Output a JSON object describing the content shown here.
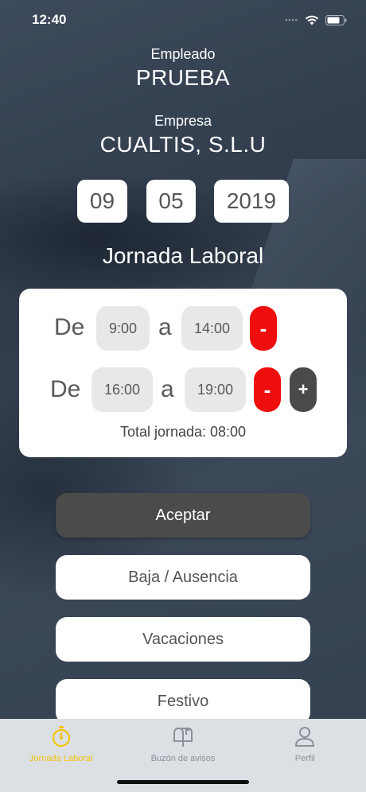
{
  "status": {
    "time": "12:40"
  },
  "employee": {
    "label": "Empleado",
    "value": "PRUEBA"
  },
  "company": {
    "label": "Empresa",
    "value": "CUALTIS, S.L.U"
  },
  "date": {
    "day": "09",
    "month": "05",
    "year": "2019"
  },
  "section_title": "Jornada Laboral",
  "shifts": [
    {
      "from_label": "De",
      "from": "9:00",
      "to_label": "a",
      "to": "14:00",
      "remove": "-"
    },
    {
      "from_label": "De",
      "from": "16:00",
      "to_label": "a",
      "to": "19:00",
      "remove": "-",
      "add": "+"
    }
  ],
  "total": "Total jornada: 08:00",
  "buttons": {
    "accept": "Aceptar",
    "leave": "Baja / Ausencia",
    "vacation": "Vacaciones",
    "holiday": "Festivo"
  },
  "tabs": [
    {
      "label": "Jornada Laboral",
      "icon": "stopwatch-icon",
      "active": true
    },
    {
      "label": "Buzón de avisos",
      "icon": "mailbox-icon",
      "active": false
    },
    {
      "label": "Perfil",
      "icon": "user-icon",
      "active": false
    }
  ],
  "colors": {
    "accent": "#f2c40a",
    "remove": "#ee0e0e",
    "dark_button": "#4b4b4b"
  }
}
